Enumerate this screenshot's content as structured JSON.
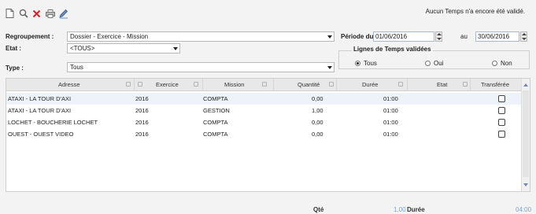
{
  "toolbar": {
    "icons": [
      "new-icon",
      "search-icon",
      "delete-icon",
      "print-icon",
      "pen-icon"
    ]
  },
  "status_message": "Aucun Temps n'a encore été validé.",
  "filters": {
    "regroupement_label": "Regroupement :",
    "regroupement_value": "Dossier - Exercice - Mission",
    "etat_label": "Etat :",
    "etat_value": "<TOUS>",
    "type_label": "Type :",
    "type_value": "Tous",
    "periode_label": "Période du",
    "date_from": "01/06/2016",
    "au_label": "au",
    "date_to": "30/06/2016"
  },
  "validated": {
    "title": "Lignes de Temps validées",
    "options": [
      "Tous",
      "Oui",
      "Non"
    ],
    "selected": "Tous"
  },
  "table": {
    "columns": [
      "Adresse",
      "Exercice",
      "Mission",
      "Quantité",
      "Durée",
      "Etat",
      "Transférée"
    ],
    "rows": [
      {
        "adresse": "ATAXI - LA TOUR D'AXI",
        "exercice": "2016",
        "mission": "COMPTA",
        "quantite": "0,00",
        "duree": "01:00",
        "etat": "",
        "transferee": false
      },
      {
        "adresse": "ATAXI - LA TOUR D'AXI",
        "exercice": "2016",
        "mission": "GESTION",
        "quantite": "1,00",
        "duree": "01:00",
        "etat": "",
        "transferee": false
      },
      {
        "adresse": "LOCHET - BOUCHERIE LOCHET",
        "exercice": "2016",
        "mission": "COMPTA",
        "quantite": "0,00",
        "duree": "01:00",
        "etat": "",
        "transferee": false
      },
      {
        "adresse": "OUEST - OUEST VIDEO",
        "exercice": "2016",
        "mission": "COMPTA",
        "quantite": "0,00",
        "duree": "01:00",
        "etat": "",
        "transferee": false
      }
    ]
  },
  "footer": {
    "qte_label": "Qté",
    "qte_value": "1,00",
    "duree_label": "Durée",
    "duree_value": "04:00"
  },
  "colors": {
    "accent": "#6a8bb6",
    "delete": "#d9242b",
    "footer_value": "#7fa3c8"
  }
}
